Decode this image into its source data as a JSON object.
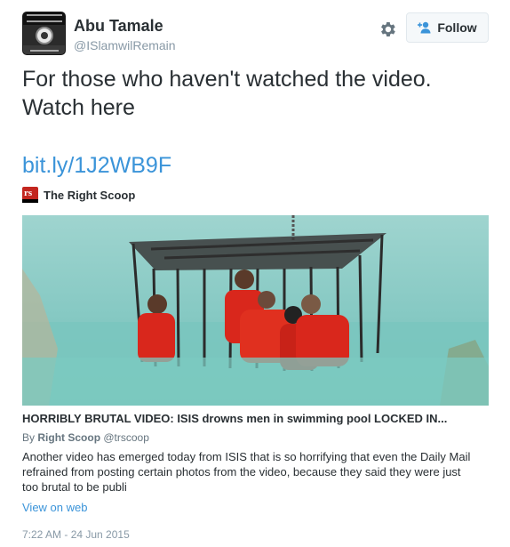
{
  "tweet": {
    "author": {
      "full_name": "Abu Tamale",
      "screen_name": "@ISlamwilRemain"
    },
    "follow_label": "Follow",
    "text": "For those who haven't watched the video. Watch here",
    "link": "bit.ly/1J2WB9F",
    "timestamp": "7:22 AM - 24 Jun 2015"
  },
  "card": {
    "source_name": "The Right Scoop",
    "title": "HORRIBLY BRUTAL VIDEO: ISIS drowns men in swimming pool LOCKED IN...",
    "byline_prefix": "By",
    "byline_author": "Right Scoop",
    "byline_handle": "@trscoop",
    "description": "Another video has emerged today from ISIS that is so horrifying that even the Daily Mail refrained from posting certain photos from the video, because they said they were just too brutal to be publi",
    "view_on_web": "View on web"
  },
  "colors": {
    "link": "#3b94d9",
    "text": "#292f33",
    "muted": "#8899a6",
    "water": "#7fc8c2",
    "jumpsuit": "#d9271c"
  },
  "icons": {
    "gear": "gear-icon",
    "follow": "add-user-icon",
    "source_logo": "right-scoop-logo"
  }
}
